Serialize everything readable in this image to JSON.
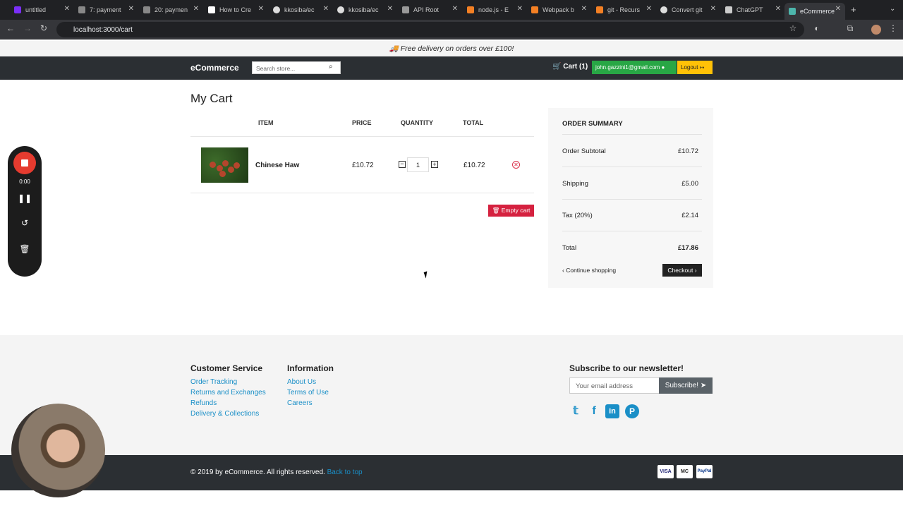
{
  "browser": {
    "tabs": [
      {
        "label": "untitled",
        "active": false
      },
      {
        "label": "7: payment",
        "active": false
      },
      {
        "label": "20: paymen",
        "active": false
      },
      {
        "label": "How to Cre",
        "active": false
      },
      {
        "label": "kkosiba/ec",
        "active": false
      },
      {
        "label": "kkosiba/ec",
        "active": false
      },
      {
        "label": "API Root",
        "active": false
      },
      {
        "label": "node.js - E",
        "active": false
      },
      {
        "label": "Webpack b",
        "active": false
      },
      {
        "label": "git - Recurs",
        "active": false
      },
      {
        "label": "Convert git",
        "active": false
      },
      {
        "label": "ChatGPT",
        "active": false
      },
      {
        "label": "eCommerce",
        "active": true
      }
    ],
    "url": "localhost:3000/cart"
  },
  "promo": {
    "text": "Free delivery on orders over £100!"
  },
  "nav": {
    "brand": "eCommerce",
    "search_placeholder": "Search store...",
    "cart": "Cart (1)",
    "user_email": "john.gazzini1@gmail.com",
    "logout": "Logout"
  },
  "cart": {
    "title": "My Cart",
    "headers": {
      "item": "ITEM",
      "price": "PRICE",
      "quantity": "QUANTITY",
      "total": "TOTAL"
    },
    "items": [
      {
        "name": "Chinese Haw",
        "price": "£10.72",
        "quantity": "1",
        "total": "£10.72"
      }
    ],
    "empty_cart": "Empty cart"
  },
  "summary": {
    "title": "ORDER SUMMARY",
    "subtotal_label": "Order Subtotal",
    "subtotal": "£10.72",
    "shipping_label": "Shipping",
    "shipping": "£5.00",
    "tax_label": "Tax (20%)",
    "tax": "£2.14",
    "total_label": "Total",
    "total": "£17.86",
    "continue": "Continue shopping",
    "checkout": "Checkout"
  },
  "footer": {
    "customer_service": {
      "title": "Customer Service",
      "links": [
        "Order Tracking",
        "Returns and Exchanges",
        "Refunds",
        "Delivery & Collections"
      ]
    },
    "information": {
      "title": "Information",
      "links": [
        "About Us",
        "Terms of Use",
        "Careers"
      ]
    },
    "newsletter": {
      "title": "Subscribe to our newsletter!",
      "placeholder": "Your email address",
      "button": "Subscribe!"
    },
    "social": [
      "twitter-icon",
      "facebook-icon",
      "linkedin-icon",
      "pinterest-icon"
    ],
    "copyright": "© 2019 by eCommerce. All rights reserved.",
    "back_to_top": "Back to top",
    "payments": [
      "VISA",
      "MC",
      "PayPal"
    ]
  },
  "recorder": {
    "time": "0:00"
  },
  "colors": {
    "navbar": "#2b2f33",
    "email_btn": "#28a745",
    "logout_btn": "#ffc107",
    "empty_cart": "#d5213f",
    "link": "#1a8fc7"
  }
}
